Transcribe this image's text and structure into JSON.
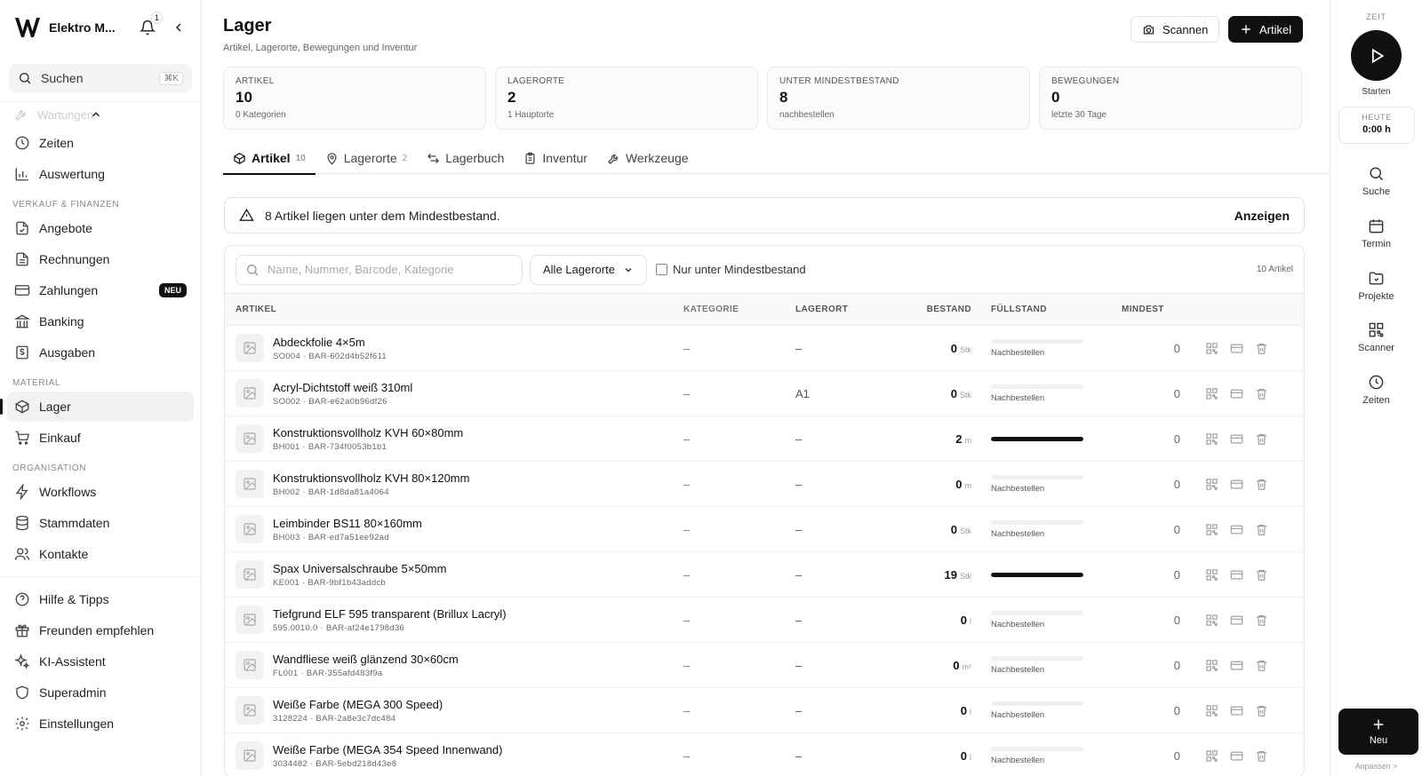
{
  "sidebar": {
    "brand": "Elektro M...",
    "notifications": "1",
    "search_label": "Suchen",
    "search_shortcut": "⌘K",
    "faded_item": "Wartungen",
    "items_top": [
      {
        "label": "Zeiten"
      },
      {
        "label": "Auswertung"
      }
    ],
    "section_sales": "VERKAUF & FINANZEN",
    "items_sales": [
      {
        "label": "Angebote"
      },
      {
        "label": "Rechnungen"
      },
      {
        "label": "Zahlungen",
        "badge": "NEU"
      },
      {
        "label": "Banking"
      },
      {
        "label": "Ausgaben"
      }
    ],
    "section_material": "MATERIAL",
    "items_material": [
      {
        "label": "Lager"
      },
      {
        "label": "Einkauf"
      }
    ],
    "section_org": "ORGANISATION",
    "items_org": [
      {
        "label": "Workflows"
      },
      {
        "label": "Stammdaten"
      },
      {
        "label": "Kontakte"
      }
    ],
    "items_bottom": [
      {
        "label": "Hilfe & Tipps"
      },
      {
        "label": "Freunden empfehlen"
      },
      {
        "label": "KI-Assistent"
      },
      {
        "label": "Superadmin"
      },
      {
        "label": "Einstellungen"
      }
    ]
  },
  "header": {
    "title": "Lager",
    "subtitle": "Artikel, Lagerorte, Bewegungen und Inventur",
    "scan_label": "Scannen",
    "add_label": "Artikel"
  },
  "stats": [
    {
      "label": "ARTIKEL",
      "value": "10",
      "sub": "0 Kategorien"
    },
    {
      "label": "LAGERORTE",
      "value": "2",
      "sub": "1 Hauptorte"
    },
    {
      "label": "UNTER MINDESTBESTAND",
      "value": "8",
      "sub": "nachbestellen"
    },
    {
      "label": "BEWEGUNGEN",
      "value": "0",
      "sub": "letzte 30 Tage"
    }
  ],
  "tabs": [
    {
      "label": "Artikel",
      "count": "10"
    },
    {
      "label": "Lagerorte",
      "count": "2"
    },
    {
      "label": "Lagerbuch"
    },
    {
      "label": "Inventur"
    },
    {
      "label": "Werkzeuge"
    }
  ],
  "alert": {
    "text": "8 Artikel liegen unter dem Mindestbestand.",
    "action": "Anzeigen"
  },
  "filters": {
    "search_placeholder": "Name, Nummer, Barcode, Kategorie",
    "location_selected": "Alle Lagerorte",
    "below_min_label": "Nur unter Mindestbestand",
    "count": "10 Artikel"
  },
  "table": {
    "headers": [
      "ARTIKEL",
      "KATEGORIE",
      "LAGERORT",
      "BESTAND",
      "FÜLLSTAND",
      "MINDEST"
    ],
    "reorder_label": "Nachbestellen",
    "rows": [
      {
        "name": "Abdeckfolie 4×5m",
        "meta": "SO004 · BAR-602d4b52f611",
        "kategorie": "–",
        "lagerort": "–",
        "bestand": "0",
        "unit": "Stk",
        "fill": 0,
        "reorder": true,
        "mindest": "0"
      },
      {
        "name": "Acryl-Dichtstoff weiß 310ml",
        "meta": "SO002 · BAR-e62a0b96df26",
        "kategorie": "–",
        "lagerort": "A1",
        "bestand": "0",
        "unit": "Stk",
        "fill": 0,
        "reorder": true,
        "mindest": "0"
      },
      {
        "name": "Konstruktionsvollholz KVH 60×80mm",
        "meta": "BH001 · BAR-734f0053b1b1",
        "kategorie": "–",
        "lagerort": "–",
        "bestand": "2",
        "unit": "m",
        "fill": 100,
        "reorder": false,
        "mindest": "0"
      },
      {
        "name": "Konstruktionsvollholz KVH 80×120mm",
        "meta": "BH002 · BAR-1d8da81a4064",
        "kategorie": "–",
        "lagerort": "–",
        "bestand": "0",
        "unit": "m",
        "fill": 0,
        "reorder": true,
        "mindest": "0"
      },
      {
        "name": "Leimbinder BS11 80×160mm",
        "meta": "BH003 · BAR-ed7a51ee92ad",
        "kategorie": "–",
        "lagerort": "–",
        "bestand": "0",
        "unit": "Stk",
        "fill": 0,
        "reorder": true,
        "mindest": "0"
      },
      {
        "name": "Spax Universalschraube 5×50mm",
        "meta": "KE001 · BAR-9bf1b43addcb",
        "kategorie": "–",
        "lagerort": "–",
        "bestand": "19",
        "unit": "Stk",
        "fill": 100,
        "reorder": false,
        "mindest": "0"
      },
      {
        "name": "Tiefgrund ELF 595 transparent (Brillux Lacryl)",
        "meta": "595.0010.0 · BAR-af24e1798d36",
        "kategorie": "–",
        "lagerort": "–",
        "bestand": "0",
        "unit": "l",
        "fill": 0,
        "reorder": true,
        "mindest": "0"
      },
      {
        "name": "Wandfliese weiß glänzend 30×60cm",
        "meta": "FL001 · BAR-355afd483f9a",
        "kategorie": "–",
        "lagerort": "–",
        "bestand": "0",
        "unit": "m²",
        "fill": 0,
        "reorder": true,
        "mindest": "0"
      },
      {
        "name": "Weiße Farbe (MEGA 300 Speed)",
        "meta": "3128224 · BAR-2a8e3c7dc484",
        "kategorie": "–",
        "lagerort": "–",
        "bestand": "0",
        "unit": "l",
        "fill": 0,
        "reorder": true,
        "mindest": "0"
      },
      {
        "name": "Weiße Farbe (MEGA 354 Speed Innenwand)",
        "meta": "3034482 · BAR-5ebd218d43e8",
        "kategorie": "–",
        "lagerort": "–",
        "bestand": "0",
        "unit": "l",
        "fill": 0,
        "reorder": true,
        "mindest": "0"
      }
    ]
  },
  "rail": {
    "zeit_label": "ZEIT",
    "start_label": "Starten",
    "today_label": "HEUTE",
    "today_value": "0:00 h",
    "items": [
      {
        "label": "Suche",
        "icon": "search-icon"
      },
      {
        "label": "Termin",
        "icon": "calendar-icon"
      },
      {
        "label": "Projekte",
        "icon": "folder-icon"
      },
      {
        "label": "Scanner",
        "icon": "qr-icon"
      },
      {
        "label": "Zeiten",
        "icon": "clock-icon"
      }
    ],
    "new_label": "Neu",
    "customize_label": "Anpassen >"
  }
}
